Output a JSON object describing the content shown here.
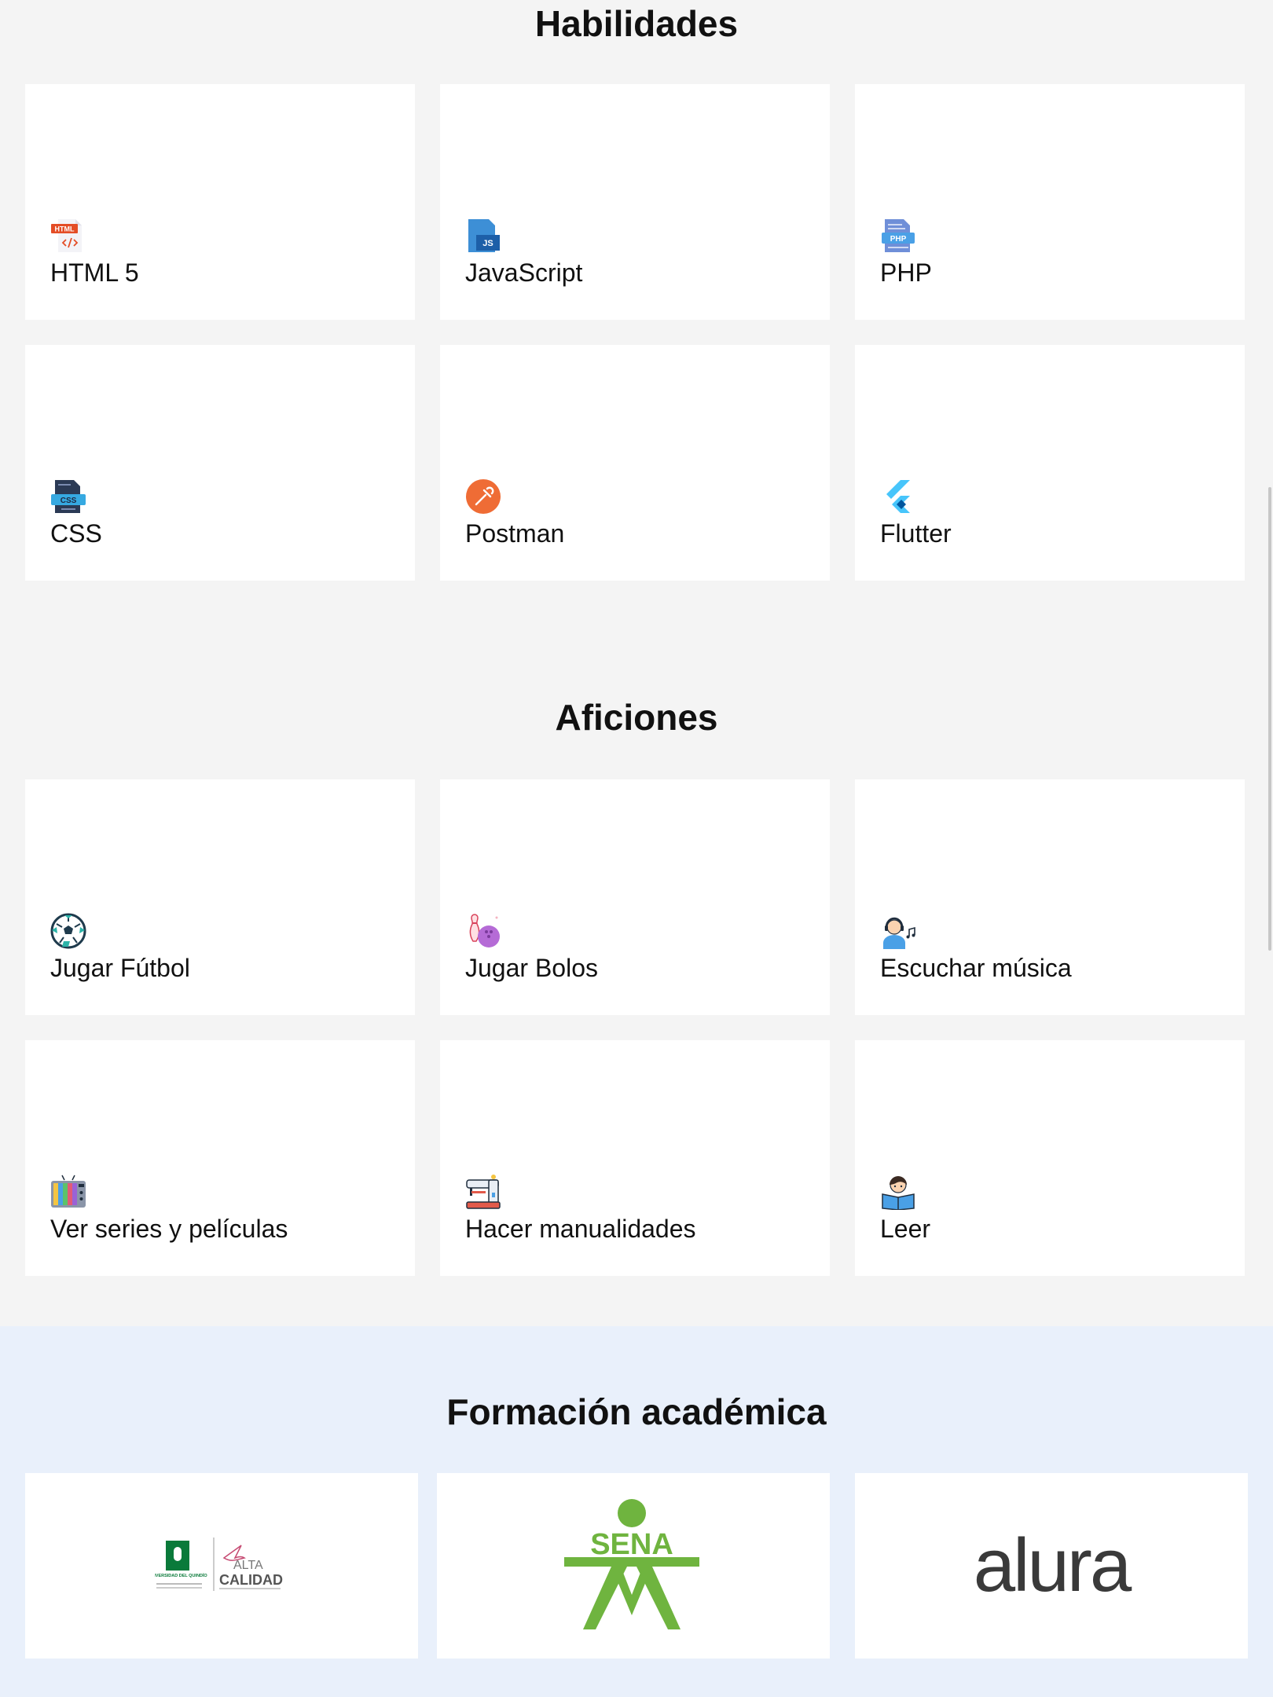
{
  "habilidades": {
    "title": "Habilidades",
    "items": [
      {
        "label": "HTML 5",
        "icon": "html5-icon"
      },
      {
        "label": "JavaScript",
        "icon": "javascript-icon"
      },
      {
        "label": "PHP",
        "icon": "php-icon"
      },
      {
        "label": "CSS",
        "icon": "css-icon"
      },
      {
        "label": "Postman",
        "icon": "postman-icon"
      },
      {
        "label": "Flutter",
        "icon": "flutter-icon"
      }
    ]
  },
  "aficiones": {
    "title": "Aficiones",
    "items": [
      {
        "label": "Jugar Fútbol",
        "icon": "soccer-ball-icon"
      },
      {
        "label": "Jugar Bolos",
        "icon": "bowling-icon"
      },
      {
        "label": "Escuchar música",
        "icon": "headphones-music-icon"
      },
      {
        "label": "Ver series y películas",
        "icon": "tv-icon"
      },
      {
        "label": "Hacer manualidades",
        "icon": "sewing-machine-icon"
      },
      {
        "label": "Leer",
        "icon": "reading-icon"
      }
    ]
  },
  "formacion": {
    "title": "Formación académica",
    "logos": [
      {
        "name": "Universidad del Quindío",
        "uq_text": "UNIVERSIDAD DEL QUINDÍO",
        "alta": "ALTA",
        "calidad": "CALIDAD"
      },
      {
        "name": "SENA",
        "text": "SENA"
      },
      {
        "name": "alura",
        "text": "alura"
      }
    ]
  },
  "colors": {
    "background": "#f4f4f4",
    "formacion_background": "#e9f0fb",
    "sena_green": "#6fb43f",
    "alura_dark": "#3a3a3a"
  }
}
